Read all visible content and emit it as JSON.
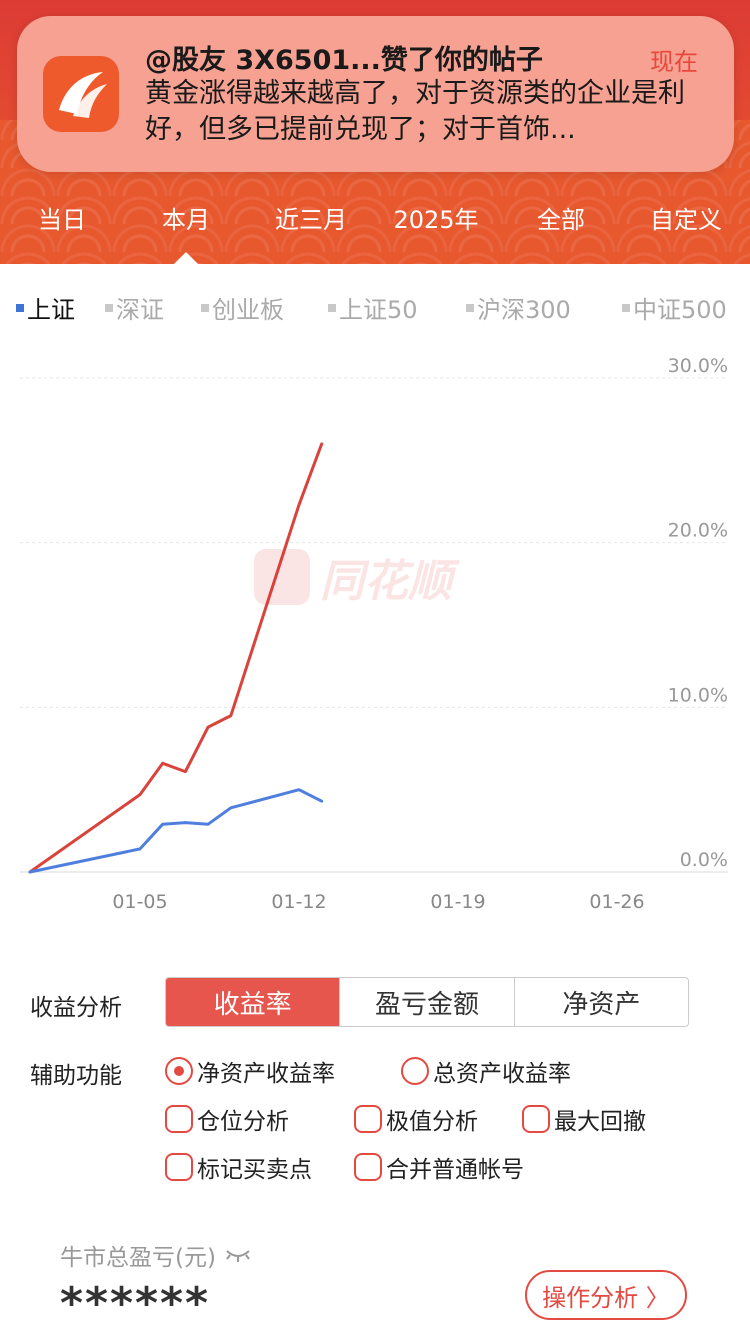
{
  "notification": {
    "title": "@股友 3X6501...赞了你的帖子",
    "time": "现在",
    "body": "黄金涨得越来越高了，对于资源类的企业是利好，但多已提前兑现了；对于首饰..."
  },
  "period_tabs": [
    "当日",
    "本月",
    "近三月",
    "2025年",
    "全部",
    "自定义"
  ],
  "period_active": "本月",
  "index_tabs": [
    "上证",
    "深证",
    "创业板",
    "上证50",
    "沪深300",
    "中证500"
  ],
  "index_active": "上证",
  "watermark": "同花顺",
  "chart_data": {
    "type": "line",
    "x_ticks": [
      "01-05",
      "01-12",
      "01-19",
      "01-26"
    ],
    "y_ticks": [
      "30.0%",
      "20.0%",
      "10.0%",
      "0.0%"
    ],
    "ylim": [
      0,
      30
    ],
    "grid": true,
    "series": [
      {
        "color": "#d9433b",
        "x": [
          "01-01",
          "01-05",
          "01-06",
          "01-07",
          "01-08",
          "01-09",
          "01-12",
          "01-13"
        ],
        "values": [
          0,
          4.7,
          6.6,
          6.1,
          8.8,
          9.5,
          22.3,
          26.0
        ]
      },
      {
        "color": "#4f7fde",
        "x": [
          "01-01",
          "01-05",
          "01-06",
          "01-07",
          "01-08",
          "01-09",
          "01-12",
          "01-13"
        ],
        "values": [
          0,
          1.4,
          2.9,
          3.0,
          2.9,
          3.9,
          5.0,
          4.3
        ]
      }
    ]
  },
  "analysis": {
    "label": "收益分析",
    "segments": [
      "收益率",
      "盈亏金额",
      "净资产"
    ],
    "active_segment": "收益率"
  },
  "aux": {
    "label": "辅助功能",
    "radios": [
      {
        "label": "净资产收益率",
        "checked": true
      },
      {
        "label": "总资产收益率",
        "checked": false
      }
    ],
    "checkboxes": [
      "仓位分析",
      "极值分析",
      "最大回撤",
      "标记买卖点",
      "合并普通帐号"
    ]
  },
  "summary": {
    "label": "牛市总盈亏(元)",
    "value": "******",
    "button": "操作分析 〉"
  }
}
